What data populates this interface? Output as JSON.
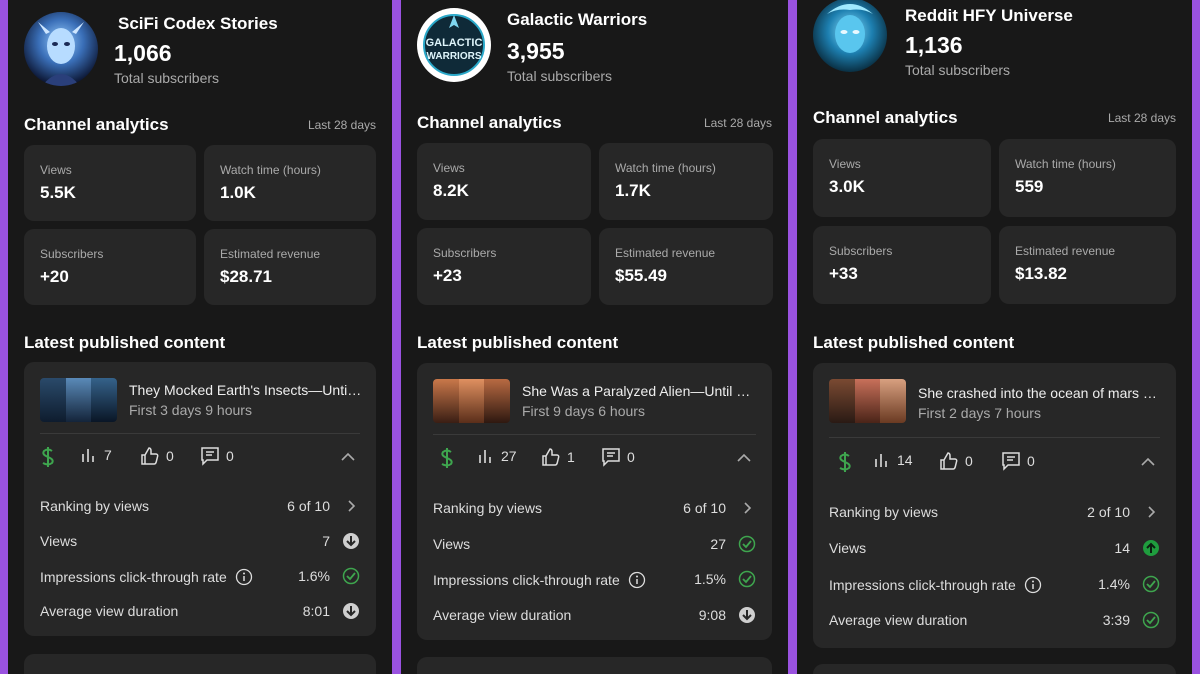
{
  "colors": {
    "frame": "#9a52e0",
    "panel": "#181818",
    "tile": "#272727",
    "money": "#3ea54e",
    "check": "#3ea54e",
    "up": "#1f9d3e",
    "down": "#cfcfcf"
  },
  "panels": [
    {
      "channel": {
        "name": "SciFi Codex Stories",
        "subscribers": "1,066",
        "subscribers_label": "Total subscribers",
        "avatar_icon": "alien-portrait-avatar"
      },
      "analytics": {
        "title": "Channel analytics",
        "period": "Last 28 days",
        "views_label": "Views",
        "views": "5.5K",
        "watch_label": "Watch time (hours)",
        "watch": "1.0K",
        "subs_label": "Subscribers",
        "subs": "+20",
        "rev_label": "Estimated revenue",
        "rev": "$28.71"
      },
      "latest": {
        "title": "Latest published content",
        "video_title": "They Mocked Earth's Insects—Until the Real Invasion Began",
        "video_sub": "First 3 days 9 hours",
        "views_count": "7",
        "likes": "0",
        "comments": "0",
        "ranking_label": "Ranking by views",
        "ranking": "6 of 10",
        "views_label": "Views",
        "views": "7",
        "views_status": "down",
        "ctr_label": "Impressions click-through rate",
        "ctr": "1.6%",
        "ctr_status": "check",
        "avd_label": "Average view duration",
        "avd": "8:01",
        "avd_status": "down"
      }
    },
    {
      "channel": {
        "name": "Galactic Warriors",
        "subscribers": "3,955",
        "subscribers_label": "Total subscribers",
        "avatar_icon": "galactic-warriors-logo",
        "avatar_text_1": "GALACTIC",
        "avatar_text_2": "WARRIORS"
      },
      "analytics": {
        "title": "Channel analytics",
        "period": "Last 28 days",
        "views_label": "Views",
        "views": "8.2K",
        "watch_label": "Watch time (hours)",
        "watch": "1.7K",
        "subs_label": "Subscribers",
        "subs": "+23",
        "rev_label": "Estimated revenue",
        "rev": "$55.49"
      },
      "latest": {
        "title": "Latest published content",
        "video_title": "She Was a Paralyzed Alien—Until a Human Changed Everything",
        "video_sub": "First 9 days 6 hours",
        "views_count": "27",
        "likes": "1",
        "comments": "0",
        "ranking_label": "Ranking by views",
        "ranking": "6 of 10",
        "views_label": "Views",
        "views": "27",
        "views_status": "check",
        "ctr_label": "Impressions click-through rate",
        "ctr": "1.5%",
        "ctr_status": "check",
        "avd_label": "Average view duration",
        "avd": "9:08",
        "avd_status": "down"
      }
    },
    {
      "channel": {
        "name": "Reddit HFY Universe",
        "subscribers": "1,136",
        "subscribers_label": "Total subscribers",
        "avatar_icon": "blue-alien-avatar"
      },
      "analytics": {
        "title": "Channel analytics",
        "period": "Last 28 days",
        "views_label": "Views",
        "views": "3.0K",
        "watch_label": "Watch time (hours)",
        "watch": "559",
        "subs_label": "Subscribers",
        "subs": "+33",
        "rev_label": "Estimated revenue",
        "rev": "$13.82"
      },
      "latest": {
        "title": "Latest published content",
        "video_title": "She crashed into the ocean of mars and a human found her",
        "video_sub": "First 2 days 7 hours",
        "views_count": "14",
        "likes": "0",
        "comments": "0",
        "ranking_label": "Ranking by views",
        "ranking": "2 of 10",
        "views_label": "Views",
        "views": "14",
        "views_status": "up",
        "ctr_label": "Impressions click-through rate",
        "ctr": "1.4%",
        "ctr_status": "check",
        "avd_label": "Average view duration",
        "avd": "3:39",
        "avd_status": "check"
      }
    }
  ]
}
